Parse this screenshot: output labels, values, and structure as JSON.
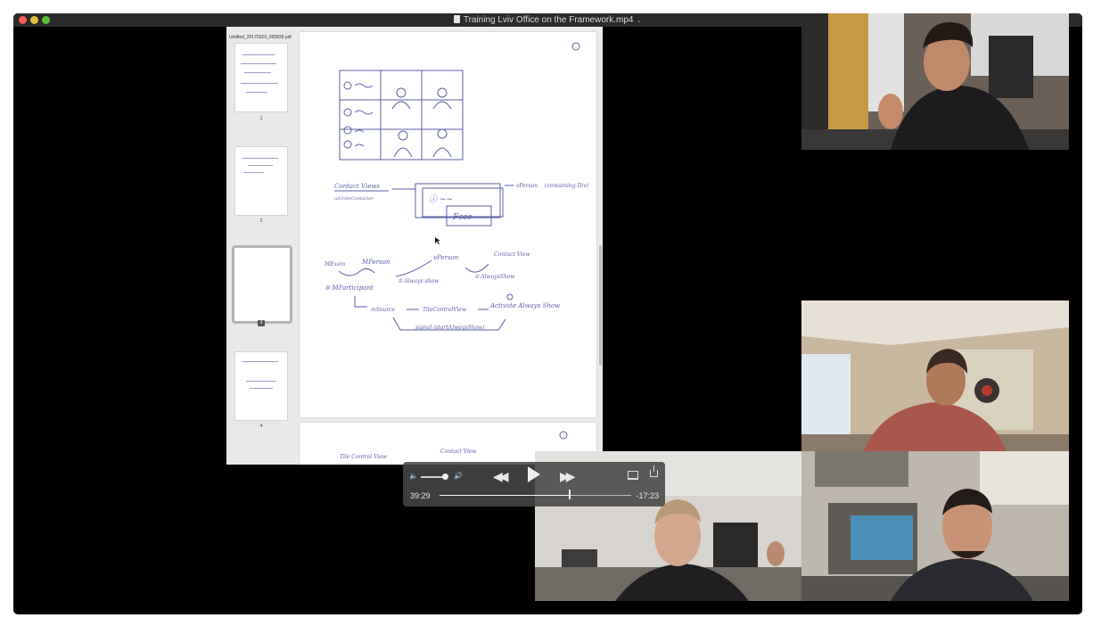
{
  "window": {
    "title": "Training Lviv Office on the Framework.mp4"
  },
  "document": {
    "filename": "Untitled_20170329_095839.pdf",
    "pages": [
      "1",
      "2",
      "3",
      "4"
    ],
    "selected_page": "3",
    "sketch_labels": {
      "contact_view": "Contact Views",
      "contact_view_sub": "uiGrideContainer",
      "face": "Fcce",
      "vperson": "vPerson",
      "containing_div": "(containing Div)",
      "mexam": "MExam",
      "mperson": "MPerson",
      "vperson2": "vPerson",
      "contact_view2": "Contact View",
      "always_show_1": "② Always show",
      "always_show_2": "① AlwaysShow",
      "mparticipant": "⑤ MParticipant",
      "msource": "mSource",
      "tile_control_view": "TileControlView",
      "activate": "Activate Always Show",
      "signal": "signal (startAlwaysShow)",
      "p2_tile": "Tile Control View",
      "p2_contact": "Contact View"
    }
  },
  "player": {
    "elapsed": "39:29",
    "remaining": "-17:23",
    "progress": 0.68,
    "volume": 0.9
  }
}
